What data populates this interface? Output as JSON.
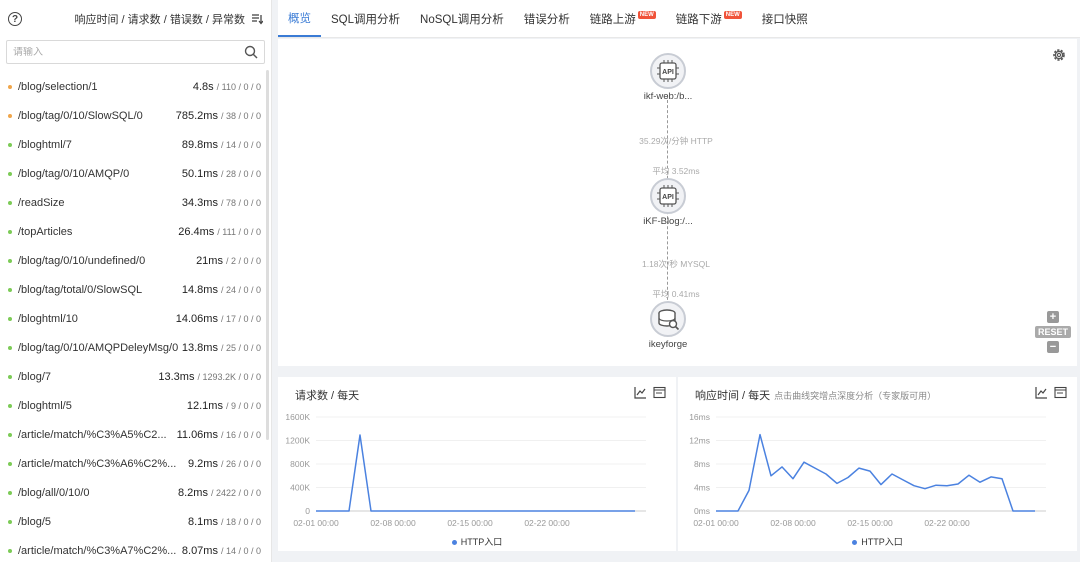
{
  "left_panel": {
    "columns_label": "响应时间 / 请求数 / 错误数 / 异常数",
    "search_placeholder": "请输入",
    "endpoints": [
      {
        "name": "/blog/selection/1",
        "time": "4.8s",
        "counts": "/ 110 / 0 / 0",
        "color": "#f0a64b"
      },
      {
        "name": "/blog/tag/0/10/SlowSQL/0",
        "time": "785.2ms",
        "counts": "/ 38 / 0 / 0",
        "color": "#f0a64b"
      },
      {
        "name": "/bloghtml/7",
        "time": "89.8ms",
        "counts": "/ 14 / 0 / 0",
        "color": "#7ccb56"
      },
      {
        "name": "/blog/tag/0/10/AMQP/0",
        "time": "50.1ms",
        "counts": "/ 28 / 0 / 0",
        "color": "#7ccb56"
      },
      {
        "name": "/readSize",
        "time": "34.3ms",
        "counts": "/ 78 / 0 / 0",
        "color": "#7ccb56"
      },
      {
        "name": "/topArticles",
        "time": "26.4ms",
        "counts": "/ 111 / 0 / 0",
        "color": "#7ccb56"
      },
      {
        "name": "/blog/tag/0/10/undefined/0",
        "time": "21ms",
        "counts": "/ 2 / 0 / 0",
        "color": "#7ccb56"
      },
      {
        "name": "/blog/tag/total/0/SlowSQL",
        "time": "14.8ms",
        "counts": "/ 24 / 0 / 0",
        "color": "#7ccb56"
      },
      {
        "name": "/bloghtml/10",
        "time": "14.06ms",
        "counts": "/ 17 / 0 / 0",
        "color": "#7ccb56"
      },
      {
        "name": "/blog/tag/0/10/AMQPDeleyMsg/0",
        "time": "13.8ms",
        "counts": "/ 25 / 0 / 0",
        "color": "#7ccb56"
      },
      {
        "name": "/blog/7",
        "time": "13.3ms",
        "counts": "/ 1293.2K / 0 / 0",
        "color": "#7ccb56"
      },
      {
        "name": "/bloghtml/5",
        "time": "12.1ms",
        "counts": "/ 9 / 0 / 0",
        "color": "#7ccb56"
      },
      {
        "name": "/article/match/%C3%A5%C2...",
        "time": "11.06ms",
        "counts": "/ 16 / 0 / 0",
        "color": "#7ccb56"
      },
      {
        "name": "/article/match/%C3%A6%C2%...",
        "time": "9.2ms",
        "counts": "/ 26 / 0 / 0",
        "color": "#7ccb56"
      },
      {
        "name": "/blog/all/0/10/0",
        "time": "8.2ms",
        "counts": "/ 2422 / 0 / 0",
        "color": "#7ccb56"
      },
      {
        "name": "/blog/5",
        "time": "8.1ms",
        "counts": "/ 18 / 0 / 0",
        "color": "#7ccb56"
      },
      {
        "name": "/article/match/%C3%A7%C2%...",
        "time": "8.07ms",
        "counts": "/ 14 / 0 / 0",
        "color": "#7ccb56"
      }
    ]
  },
  "tabs": [
    {
      "label": "概览",
      "active": true,
      "new": false
    },
    {
      "label": "SQL调用分析",
      "active": false,
      "new": false
    },
    {
      "label": "NoSQL调用分析",
      "active": false,
      "new": false
    },
    {
      "label": "错误分析",
      "active": false,
      "new": false
    },
    {
      "label": "链路上游",
      "active": false,
      "new": true
    },
    {
      "label": "链路下游",
      "active": false,
      "new": true
    },
    {
      "label": "接口快照",
      "active": false,
      "new": false
    }
  ],
  "new_badge": "NEW",
  "topology": {
    "nodes": [
      {
        "label": "ikf-web:/b...",
        "icon": "api-chip-icon",
        "icon_text": "API"
      },
      {
        "label": "iKF-Blog:/...",
        "icon": "api-chip-icon",
        "icon_text": "API"
      },
      {
        "label": "ikeyforge",
        "icon": "database-icon"
      }
    ],
    "edges": [
      {
        "rate": "35.29次/分钟 HTTP",
        "avg": "平均 3.52ms"
      },
      {
        "rate": "1.18次/秒 MYSQL",
        "avg": "平均 0.41ms"
      }
    ],
    "reset_label": "RESET",
    "zoom_in_label": "+",
    "zoom_out_label": "−"
  },
  "charts": {
    "requests": {
      "title": "请求数 / 每天",
      "subtitle": "",
      "legend": "HTTP入口"
    },
    "response": {
      "title": "响应时间 / 每天",
      "subtitle": "点击曲线突增点深度分析（专家版可用）",
      "legend": "HTTP入口"
    }
  },
  "chart_data": [
    {
      "type": "line",
      "title": "请求数 / 每天",
      "xlabel": "",
      "ylabel": "",
      "x_ticks": [
        "02-01 00:00",
        "02-08 00:00",
        "02-15 00:00",
        "02-22 00:00"
      ],
      "y_ticks": [
        "0",
        "400K",
        "800K",
        "1200K",
        "1600K"
      ],
      "ylim": [
        0,
        1600
      ],
      "y_unit": "K",
      "x_range_days": [
        0,
        30
      ],
      "series": [
        {
          "name": "HTTP入口",
          "color": "#4b82e0",
          "x": [
            0,
            1,
            2,
            3,
            4,
            5,
            6,
            7,
            8,
            9,
            10,
            11,
            12,
            13,
            14,
            15,
            16,
            17,
            18,
            19,
            20,
            21,
            22,
            23,
            24,
            25,
            26,
            27,
            28,
            29
          ],
          "values": [
            0,
            0,
            0,
            0,
            1293,
            0,
            0,
            0,
            0,
            0,
            0,
            0,
            0,
            0,
            0,
            0,
            0,
            0,
            0,
            0,
            0,
            0,
            0,
            0,
            0,
            0,
            0,
            0,
            0,
            0
          ]
        }
      ]
    },
    {
      "type": "line",
      "title": "响应时间 / 每天",
      "xlabel": "",
      "ylabel": "",
      "x_ticks": [
        "02-01 00:00",
        "02-08 00:00",
        "02-15 00:00",
        "02-22 00:00"
      ],
      "y_ticks": [
        "0ms",
        "4ms",
        "8ms",
        "12ms",
        "16ms"
      ],
      "ylim": [
        0,
        16
      ],
      "y_unit": "ms",
      "x_range_days": [
        0,
        30
      ],
      "series": [
        {
          "name": "HTTP入口",
          "color": "#4b82e0",
          "x": [
            0,
            1,
            2,
            3,
            4,
            5,
            6,
            7,
            8,
            9,
            10,
            11,
            12,
            13,
            14,
            15,
            16,
            17,
            18,
            19,
            20,
            21,
            22,
            23,
            24,
            25,
            26,
            27,
            28,
            29
          ],
          "values": [
            0,
            0,
            0,
            3.5,
            13,
            6,
            7.5,
            5.5,
            8.3,
            7.3,
            6.3,
            4.7,
            5.7,
            7.3,
            6.8,
            4.5,
            6.3,
            5.3,
            4.3,
            3.8,
            4.4,
            4.3,
            4.6,
            6.1,
            4.9,
            5.8,
            5.5,
            0,
            0,
            0
          ]
        }
      ]
    }
  ]
}
